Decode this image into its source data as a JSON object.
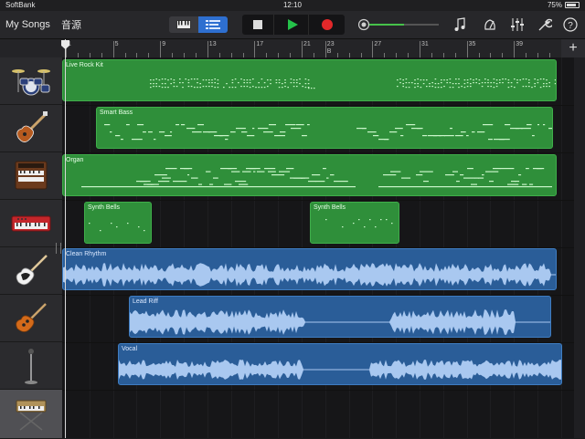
{
  "status_bar": {
    "carrier": "SoftBank",
    "time": "12:10",
    "battery": "75%",
    "battery_level": 0.75
  },
  "toolbar": {
    "my_songs": "My Songs",
    "sound_library": "音源",
    "view_icons": [
      "keyboard-icon",
      "tracks-view-icon"
    ],
    "transport": [
      "stop-icon",
      "play-icon",
      "record-icon"
    ],
    "master_volume": 0.1,
    "right_icons": [
      "loop-browser-icon",
      "metronome-icon",
      "mixer-icon",
      "settings-icon",
      "help-icon"
    ]
  },
  "ruler": {
    "bars": [
      "1",
      "5",
      "9",
      "13",
      "17",
      "21",
      "23",
      "27",
      "31",
      "35",
      "39",
      "43"
    ],
    "section_marker": "B",
    "add_button": "+"
  },
  "tracks": [
    {
      "instrument": "drum-kit-icon",
      "regions": [
        {
          "name": "Live Rock Kit",
          "type": "midi"
        }
      ]
    },
    {
      "instrument": "bass-guitar-icon",
      "regions": [
        {
          "name": "Smart Bass",
          "type": "midi"
        }
      ]
    },
    {
      "instrument": "organ-icon",
      "regions": [
        {
          "name": "Organ",
          "type": "midi"
        }
      ]
    },
    {
      "instrument": "keyboard-synth-icon",
      "regions": [
        {
          "name": "Synth Bells",
          "type": "midi"
        },
        {
          "name": "Synth Bells",
          "type": "midi"
        }
      ]
    },
    {
      "instrument": "electric-guitar-icon",
      "regions": [
        {
          "name": "Clean Rhythm",
          "type": "audio"
        }
      ]
    },
    {
      "instrument": "guitar-amp-icon",
      "regions": [
        {
          "name": "Lead Riff",
          "type": "audio"
        }
      ]
    },
    {
      "instrument": "microphone-icon",
      "regions": [
        {
          "name": "Vocal",
          "type": "audio"
        }
      ]
    },
    {
      "instrument": "keyboard-stand-icon",
      "regions": []
    }
  ],
  "colors": {
    "midi": "#2f8f3a",
    "audio": "#2a5d98",
    "record": "#e2282a",
    "play": "#25c24a",
    "accent": "#38a3f5"
  }
}
